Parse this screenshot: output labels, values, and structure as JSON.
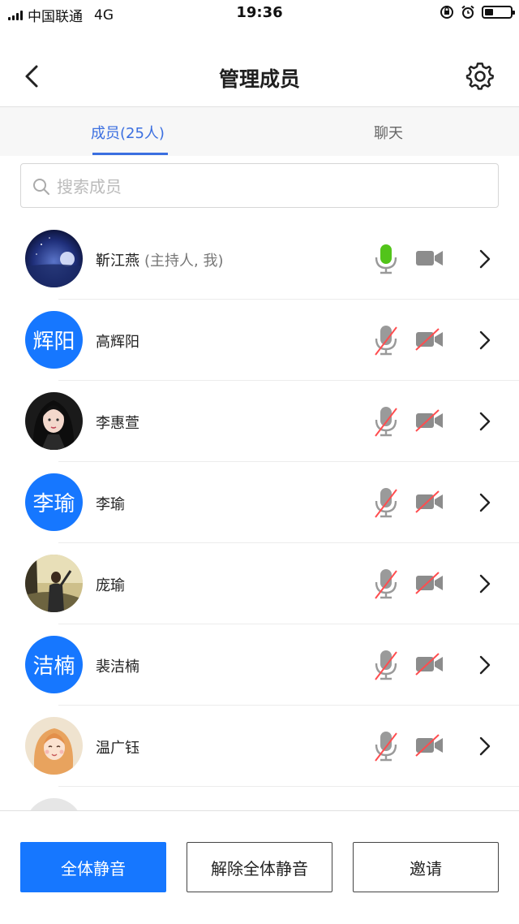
{
  "status_bar": {
    "carrier": "中国联通",
    "network": "4G",
    "time": "19:36"
  },
  "nav": {
    "title": "管理成员"
  },
  "tabs": [
    {
      "label": "成员(25人)",
      "active": true
    },
    {
      "label": "聊天",
      "active": false
    }
  ],
  "search": {
    "placeholder": "搜索成员",
    "value": ""
  },
  "colors": {
    "accent": "#1677ff",
    "tab_active": "#3b6fe0",
    "mic_on": "#52c41a",
    "muted_slash": "#ff4d4f"
  },
  "members": [
    {
      "name": "靳江燕",
      "role": "(主持人, 我)",
      "avatar_text": "",
      "avatar_icon": "moon-night-photo",
      "mic": "on",
      "camera": "off"
    },
    {
      "name": "高辉阳",
      "role": "",
      "avatar_text": "辉阳",
      "avatar_icon": "",
      "mic": "muted",
      "camera": "muted"
    },
    {
      "name": "李惠萱",
      "role": "",
      "avatar_text": "",
      "avatar_icon": "illustrated-girl-photo",
      "mic": "muted",
      "camera": "muted"
    },
    {
      "name": "李瑜",
      "role": "",
      "avatar_text": "李瑜",
      "avatar_icon": "",
      "mic": "muted",
      "camera": "muted"
    },
    {
      "name": "庞瑜",
      "role": "",
      "avatar_text": "",
      "avatar_icon": "outdoor-person-photo",
      "mic": "muted",
      "camera": "muted"
    },
    {
      "name": "裴洁楠",
      "role": "",
      "avatar_text": "洁楠",
      "avatar_icon": "",
      "mic": "muted",
      "camera": "muted"
    },
    {
      "name": "温广钰",
      "role": "",
      "avatar_text": "",
      "avatar_icon": "cartoon-girl-photo",
      "mic": "muted",
      "camera": "muted"
    }
  ],
  "actions": {
    "mute_all": "全体静音",
    "unmute_all": "解除全体静音",
    "invite": "邀请"
  }
}
